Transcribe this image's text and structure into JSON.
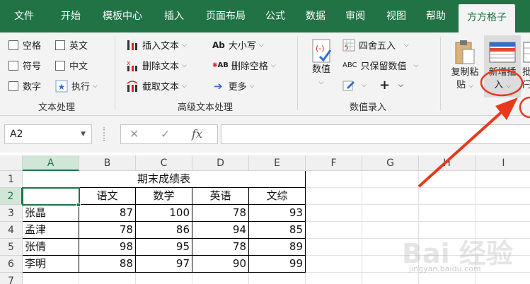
{
  "menu": {
    "tabs": [
      "文件",
      "开始",
      "模板中心",
      "插入",
      "页面布局",
      "公式",
      "数据",
      "审阅",
      "视图",
      "帮助",
      "方方格子"
    ],
    "active_tab": "方方格子"
  },
  "ribbon": {
    "text_group": {
      "label": "文本处理",
      "options": [
        "空格",
        "英文",
        "符号",
        "中文",
        "数字"
      ],
      "execute": "执行"
    },
    "advanced_group": {
      "label": "高级文本处理",
      "insert_text": "插入文本",
      "delete_text": "删除文本",
      "extract_text": "截取文本",
      "case": "大小写",
      "case_icon_text": "Ab",
      "delete_spaces": "删除空格",
      "delete_spaces_icon_text": "AB",
      "more": "更多"
    },
    "number_group": {
      "label": "数值录入",
      "numeric": "数值",
      "round": "四舍五入",
      "keep_numbers": "只保留数值",
      "keep_numbers_icon_text": "ABC",
      "plus": "+"
    },
    "copy_paste": {
      "line1": "复制粘",
      "line2": "贴"
    },
    "new_insert": {
      "line1": "新增插",
      "line2": "入"
    },
    "batch_partial": {
      "line1": "批",
      "line2": "闩"
    }
  },
  "formula_bar": {
    "name_box": "A2",
    "fx": "fx",
    "cancel": "✕",
    "confirm": "✓",
    "value": ""
  },
  "sheet": {
    "columns": [
      "A",
      "B",
      "C",
      "D",
      "E",
      "F",
      "G",
      "H",
      "I"
    ],
    "rows": [
      "1",
      "2",
      "3",
      "4",
      "5",
      "6",
      "7"
    ],
    "title": "期末成绩表",
    "headers": [
      "",
      "语文",
      "数学",
      "英语",
      "文综"
    ],
    "data": [
      [
        "张晶",
        "87",
        "100",
        "78",
        "93"
      ],
      [
        "孟津",
        "78",
        "86",
        "94",
        "85"
      ],
      [
        "张倩",
        "98",
        "95",
        "78",
        "89"
      ],
      [
        "李明",
        "88",
        "97",
        "90",
        "99"
      ]
    ],
    "selected_cell": "A2"
  },
  "watermark": "Bai 经验",
  "watermark_sub": "jingyan.baidu.com",
  "colors": {
    "brand": "#217346",
    "annotation": "#e8391d"
  }
}
